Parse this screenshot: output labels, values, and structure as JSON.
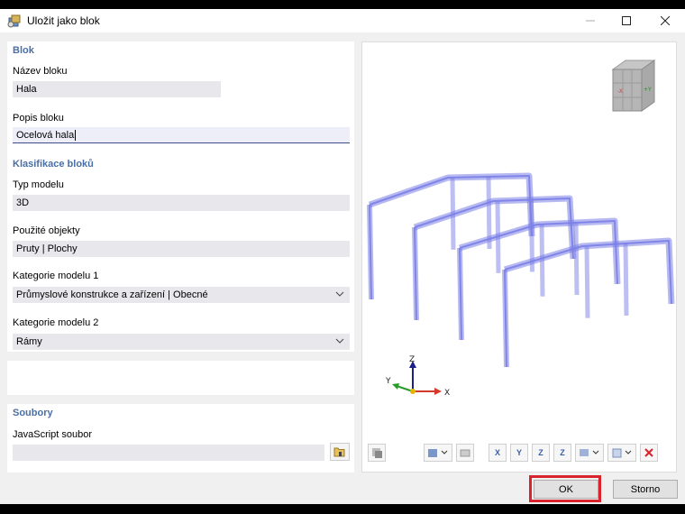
{
  "window": {
    "title": "Uložit jako blok"
  },
  "blok": {
    "heading": "Blok",
    "name_label": "Název bloku",
    "name_value": "Hala",
    "desc_label": "Popis bloku",
    "desc_value": "Ocelová hala"
  },
  "klasifikace": {
    "heading": "Klasifikace bloků",
    "model_type_label": "Typ modelu",
    "model_type_value": "3D",
    "used_objects_label": "Použité objekty",
    "used_objects_value": "Pruty | Plochy",
    "category1_label": "Kategorie modelu 1",
    "category1_value": "Průmyslové konstrukce a zařízení | Obecné",
    "category2_label": "Kategorie modelu 2",
    "category2_value": "Rámy"
  },
  "soubory": {
    "heading": "Soubory",
    "js_label": "JavaScript soubor",
    "js_value": ""
  },
  "viewport": {
    "axis_z": "Z",
    "axis_y": "Y",
    "axis_x": "X",
    "cube_label_x": "-X",
    "cube_label_y": "+Y",
    "frame_color": "#7b7fe6",
    "toolbar": [
      "X",
      "Y",
      "Z",
      "Z"
    ]
  },
  "footer": {
    "ok_label": "OK",
    "cancel_label": "Storno"
  },
  "colors": {
    "accent": "#4a6fa5",
    "highlight": "#d9232d"
  }
}
